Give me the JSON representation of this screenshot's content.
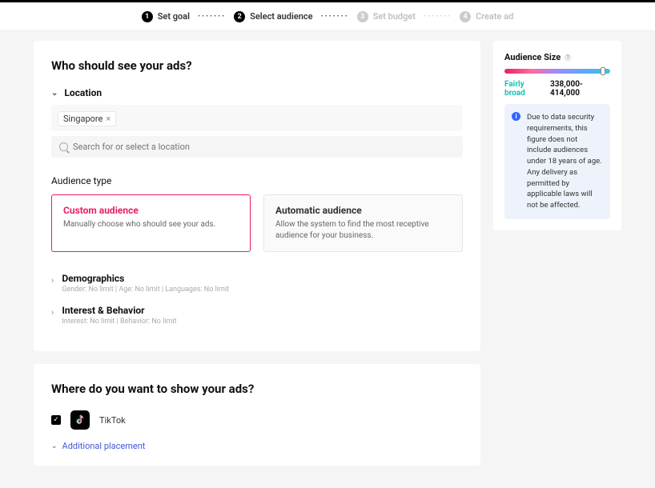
{
  "stepper": {
    "steps": [
      {
        "num": "1",
        "label": "Set goal",
        "active": true
      },
      {
        "num": "2",
        "label": "Select audience",
        "active": true
      },
      {
        "num": "3",
        "label": "Set budget",
        "active": false
      },
      {
        "num": "4",
        "label": "Create ad",
        "active": false
      }
    ]
  },
  "audience_card": {
    "title": "Who should see your ads?",
    "location": {
      "label": "Location",
      "chips": [
        "Singapore"
      ],
      "search_placeholder": "Search for or select a location"
    },
    "audience_type": {
      "label": "Audience type",
      "options": [
        {
          "title": "Custom audience",
          "desc": "Manually choose who should see your ads.",
          "selected": true
        },
        {
          "title": "Automatic audience",
          "desc": "Allow the system to find the most receptive audience for your business.",
          "selected": false
        }
      ]
    },
    "collapsed": [
      {
        "title": "Demographics",
        "sub": "Gender: No limit | Age: No limit | Languages: No limit"
      },
      {
        "title": "Interest & Behavior",
        "sub": "Interest: No limit | Behavior: No limit"
      }
    ]
  },
  "placement_card": {
    "title": "Where do you want to show your ads?",
    "item": {
      "checked": true,
      "label": "TikTok"
    },
    "additional": "Additional placement"
  },
  "side": {
    "title": "Audience Size",
    "broad_label": "Fairly broad",
    "broad_value": "338,000-414,000",
    "notice": "Due to data security requirements, this figure does not include audiences under 18 years of age. Any delivery as permitted by applicable laws will not be affected."
  }
}
